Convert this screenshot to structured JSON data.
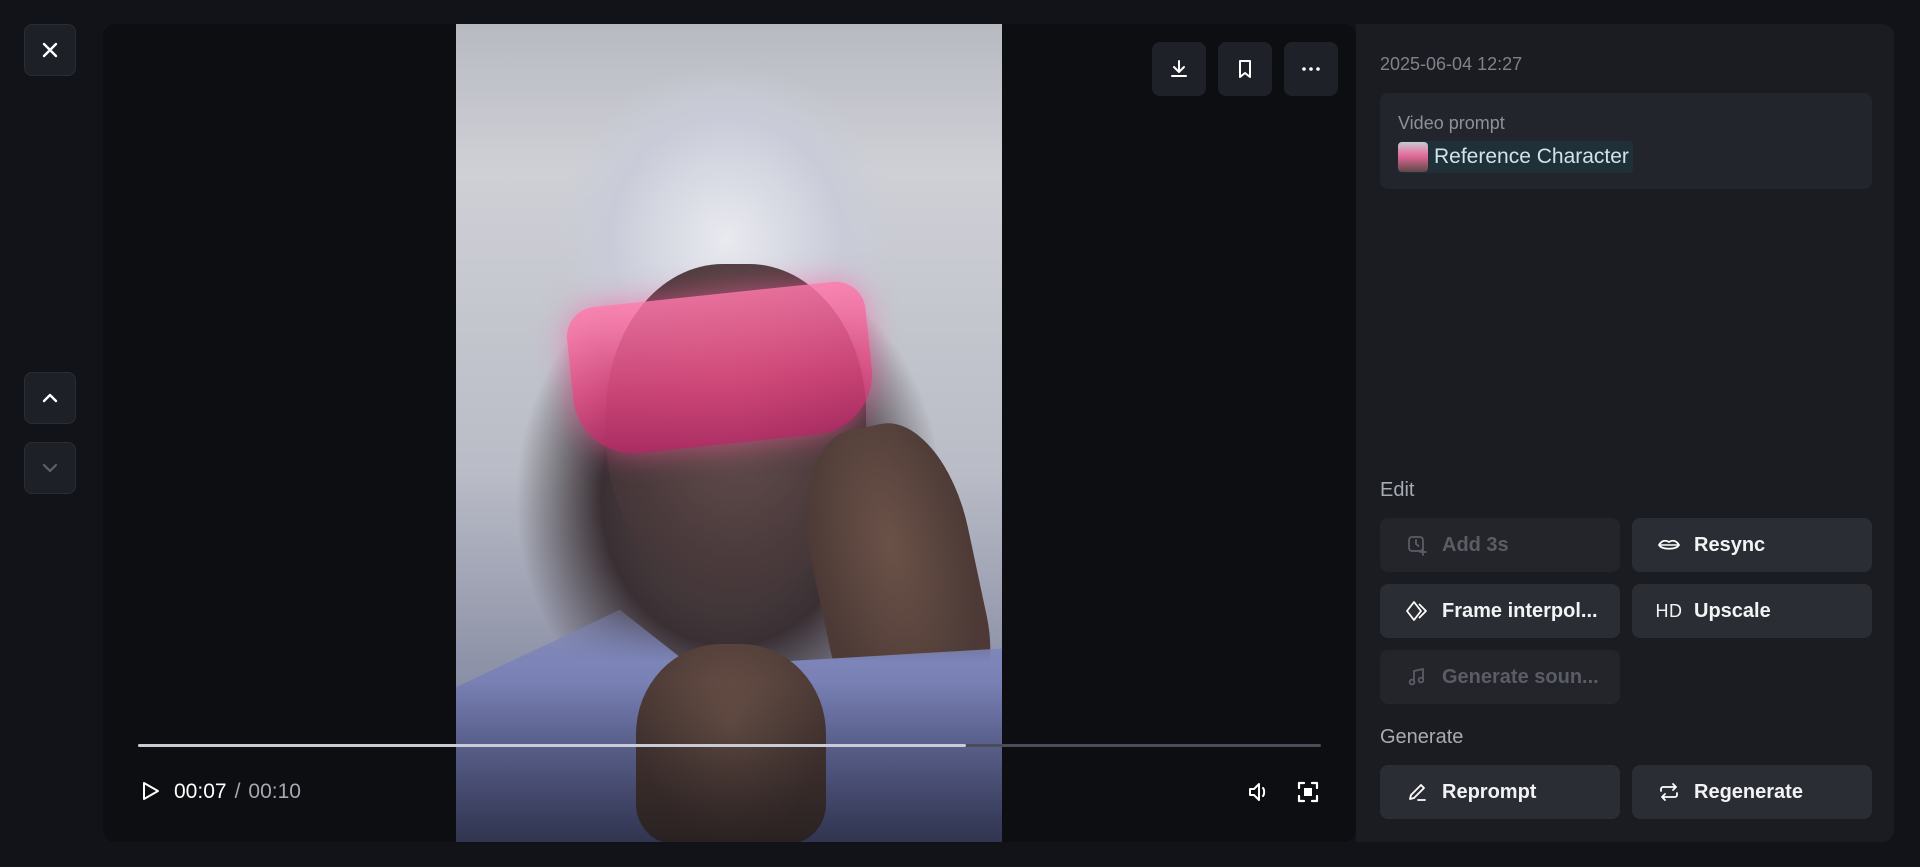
{
  "player": {
    "current_time": "00:07",
    "separator": "/",
    "total_time": "00:10",
    "progress_fraction": 0.7
  },
  "toolbar": {
    "download_icon": "download-icon",
    "bookmark_icon": "bookmark-icon",
    "more_icon": "more-horizontal-icon"
  },
  "nav": {
    "close_icon": "close-icon",
    "up_icon": "chevron-up-icon",
    "down_icon": "chevron-down-icon"
  },
  "panel": {
    "timestamp": "2025-06-04 12:27",
    "prompt_label": "Video prompt",
    "reference_chip": "Reference Character",
    "edit_title": "Edit",
    "generate_title": "Generate"
  },
  "edit_actions": {
    "add3s": "Add 3s",
    "resync": "Resync",
    "frame_interp": "Frame interpol...",
    "upscale": "Upscale",
    "upscale_icon_text": "HD",
    "generate_sound": "Generate soun..."
  },
  "generate_actions": {
    "reprompt": "Reprompt",
    "regenerate": "Regenerate"
  },
  "colors": {
    "background": "#121318",
    "panel": "#1a1c22",
    "button": "#2b2d34",
    "chip": "#203038"
  }
}
